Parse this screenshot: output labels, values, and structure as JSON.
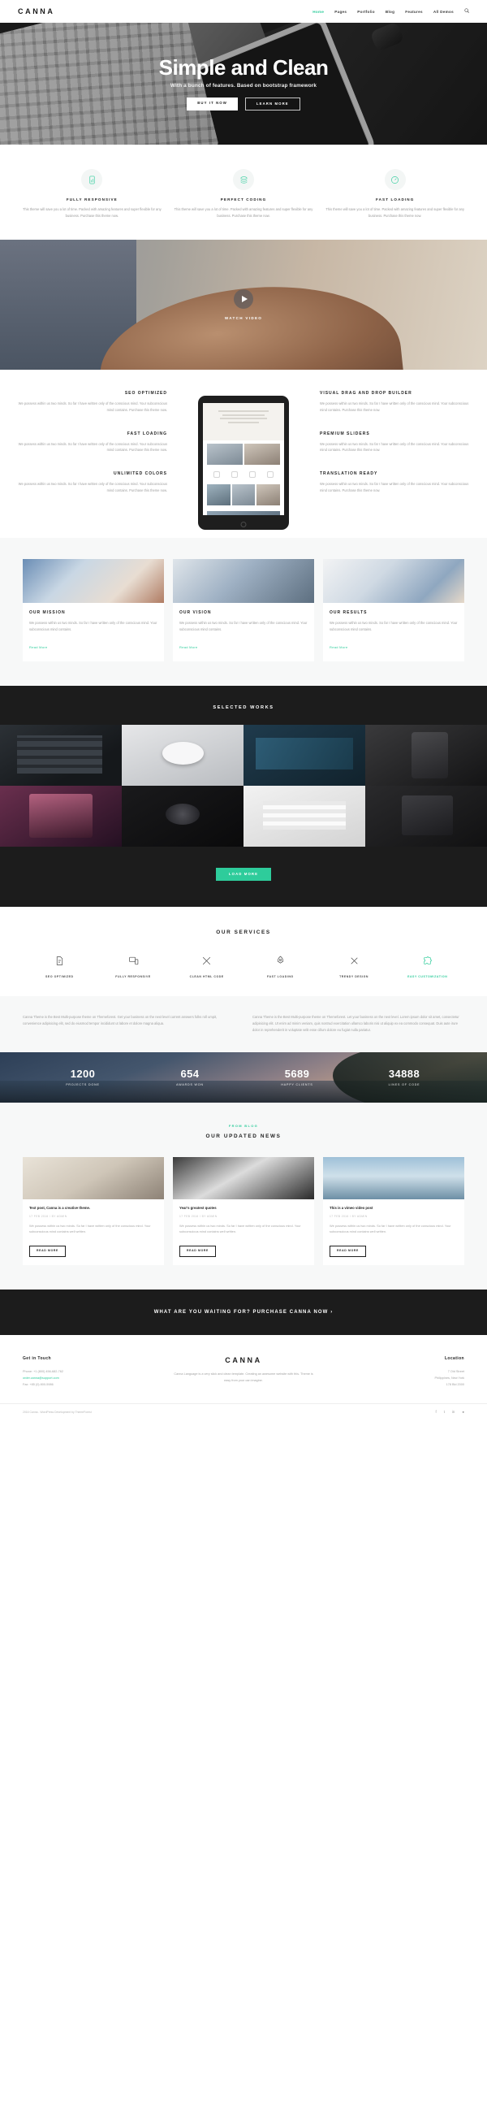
{
  "nav": {
    "logo": "CANNA",
    "links": [
      {
        "label": "Home",
        "active": true
      },
      {
        "label": "Pages",
        "active": false
      },
      {
        "label": "Portfolio",
        "active": false
      },
      {
        "label": "Blog",
        "active": false
      },
      {
        "label": "Features",
        "active": false
      },
      {
        "label": "All Demos",
        "active": false
      }
    ],
    "search_icon": "search-icon"
  },
  "hero": {
    "title": "Simple and Clean",
    "subtitle": "With a bunch of features. Based on bootstrap framework",
    "primary_button": "BUY IT NOW",
    "secondary_button": "LEARN MORE"
  },
  "features": {
    "items": [
      {
        "icon": "mobile-device-icon",
        "title": "FULLY RESPONSIVE",
        "text": "This theme will save you a lot of time. Packed with amazing features and super flexible for any business. Purchase this theme now."
      },
      {
        "icon": "layers-stack-icon",
        "title": "PERFECT CODING",
        "text": "This theme will save you a lot of time. Packed with amazing features and super flexible for any business. Purchase this theme now."
      },
      {
        "icon": "speedometer-icon",
        "title": "FAST LOADING",
        "text": "This theme will save you a lot of time. Packed with amazing features and super flexible for any business. Purchase this theme now."
      }
    ]
  },
  "video": {
    "play_icon": "play-icon",
    "label": "WATCH VIDEO"
  },
  "tablet_features": {
    "left": [
      {
        "title": "SEO OPTIMIZED",
        "text": "We possess within us two minds. So far I have written only of the conscious mind. Your subconscious mind contains. Purchase this theme now."
      },
      {
        "title": "FAST LOADING",
        "text": "We possess within us two minds. So far I have written only of the conscious mind. Your subconscious mind contains. Purchase this theme now."
      },
      {
        "title": "UNLIMITED COLORS",
        "text": "We possess within us two minds. So far I have written only of the conscious mind. Your subconscious mind contains. Purchase this theme now."
      }
    ],
    "right": [
      {
        "title": "VISUAL DRAG AND DROP BUILDER",
        "text": "We possess within us two minds. So far I have written only of the conscious mind. Your subconscious mind contains. Purchase this theme now."
      },
      {
        "title": "PREMIUM SLIDERS",
        "text": "We possess within us two minds. So far I have written only of the conscious mind. Your subconscious mind contains. Purchase this theme now."
      },
      {
        "title": "TRANSLATION READY",
        "text": "We possess within us two minds. So far I have written only of the conscious mind. Your subconscious mind contains. Purchase this theme now."
      }
    ]
  },
  "cards": [
    {
      "title": "OUR MISSION",
      "text": "We possess within us two minds. So far I have written only of the conscious mind. Your subconscious mind contains.",
      "link": "Read More"
    },
    {
      "title": "OUR VISION",
      "text": "We possess within us two minds. So far I have written only of the conscious mind. Your subconscious mind contains.",
      "link": "Read More"
    },
    {
      "title": "OUR RESULTS",
      "text": "We possess within us two minds. So far I have written only of the conscious mind. Your subconscious mind contains.",
      "link": "Read More"
    }
  ],
  "portfolio": {
    "title": "SELECTED WORKS",
    "load_more": "LOAD MORE"
  },
  "services": {
    "title": "OUR SERVICES",
    "items": [
      {
        "icon": "seo-document-icon",
        "label": "SEO OPTIMIZED",
        "active": false
      },
      {
        "icon": "responsive-screens-icon",
        "label": "FULLY RESPONSIVE",
        "active": false
      },
      {
        "icon": "code-tools-icon",
        "label": "CLEAN HTML CODE",
        "active": false
      },
      {
        "icon": "rocket-icon",
        "label": "FAST LOADING",
        "active": false
      },
      {
        "icon": "trendy-pen-icon",
        "label": "TRENDY DESIGN",
        "active": false
      },
      {
        "icon": "puzzle-icon",
        "label": "EASY CUSTOMIZATION",
        "active": true
      }
    ]
  },
  "about_text": {
    "left": "Canna Theme is the Best Multi-purpose theme on Themeforest. Get your business on the next level current answers folks roll umpit, convenience adipisicing elit, sed do eiusmod tempor incididunt ut labore et dolore magna aliqua.",
    "right": "Canna Theme is the Best Multi-purpose theme on Themeforest. Let your business on the next level. Lorem ipsum dolor sit amet, consectetur adipisicing elit.\n\nUt enim ad minim veniam, quis nostrud exercitation ullamco laboris nisi ut aliquip ex ea commodo consequat. Duis aute irure dolor in reprehenderit in voluptate velit esse cillum dolore eu fugiat nulla pariatur."
  },
  "counters": [
    {
      "value": "1200",
      "label": "PROJECTS DONE"
    },
    {
      "value": "654",
      "label": "AWARDS WON"
    },
    {
      "value": "5689",
      "label": "HAPPY CLIENTS"
    },
    {
      "value": "34888",
      "label": "LINES OF CODE"
    }
  ],
  "blog": {
    "kicker": "FROM BLOG",
    "title": "OUR UPDATED NEWS",
    "posts": [
      {
        "title": "Text post, Canna is a creative theme.",
        "meta": "17 FEB 2016  /  BY ADMIN",
        "text": "We possess within us two minds. So far I have written only of the conscious mind. Your subconscious mind contains well written.",
        "button": "READ MORE"
      },
      {
        "title": "Year's greatest quotes",
        "meta": "17 FEB 2016  /  BY ADMIN",
        "text": "We possess within us two minds. So far I have written only of the conscious mind. Your subconscious mind contains well written.",
        "button": "READ MORE"
      },
      {
        "title": "This is a vimeo video post",
        "meta": "17 FEB 2016  /  BY ADMIN",
        "text": "We possess within us two minds. So far I have written only of the conscious mind. Your subconscious mind contains well written.",
        "button": "READ MORE"
      }
    ]
  },
  "cta": {
    "text": "WHAT ARE YOU WAITING FOR? PURCHASE CANNA NOW ›"
  },
  "footer": {
    "contact": {
      "heading": "Get in Touch",
      "phone": "Phone: +1 (800) 456-682-762",
      "email": "order.canna@support.com",
      "fax": "Fax: +85 (0) 800-5986"
    },
    "about": {
      "logo": "CANNA",
      "text": "Canna Language is a very slick and clean template. Creating an awesome website with this. Theme is easy from your can imagine."
    },
    "location": {
      "heading": "Location",
      "lines": [
        "7 Old Street",
        "Philippines, New York",
        "178 Bld 2000"
      ]
    }
  },
  "footer_bottom": {
    "copyright": "2016 Canna - WordPress Development by ThemeForest",
    "socials": [
      "facebook-icon",
      "twitter-icon",
      "linkedin-icon",
      "dribbble-icon"
    ]
  },
  "colors": {
    "accent": "#2ecc9b",
    "dark": "#1c1c1c",
    "muted": "#a0a0a0"
  }
}
